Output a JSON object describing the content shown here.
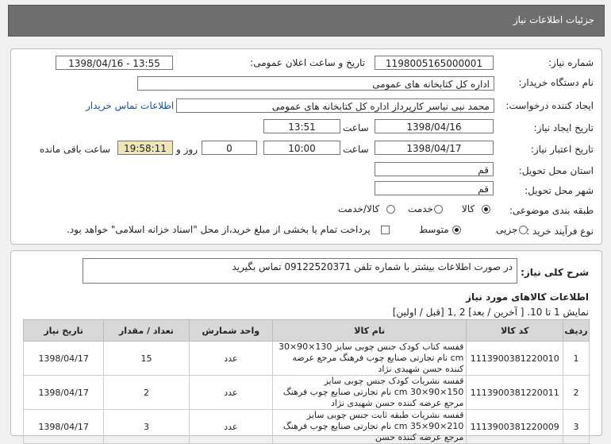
{
  "header": {
    "title": "جزئیات اطلاعات نیاز"
  },
  "form": {
    "need_number_label": "شماره نیاز:",
    "need_number": "1198005165000001",
    "announce_label": "تاریخ و ساعت اعلان عمومی:",
    "announce_value": "1398/04/16 - 13:55",
    "buyer_label": "نام دستگاه خریدار:",
    "buyer_value": "اداره کل کتابخانه های عمومی",
    "requester_label": "ایجاد کننده درخواست:",
    "requester_value": "محمد نبی نیاسر کارپرداز اداره کل کتابخانه های عمومی",
    "contact_link": "اطلاعات تماس خریدار",
    "create_date_label": "تاریخ ایجاد نیاز:",
    "create_date": "1398/04/16",
    "time_label": "ساعت",
    "create_time": "13:51",
    "valid_date_label": "تاریخ اعتبار نیاز:",
    "valid_date": "1398/04/17",
    "valid_time": "10:00",
    "days_value": "0",
    "days_label": "روز و",
    "remaining_time": "19:58:11",
    "remaining_label": "ساعت باقی مانده",
    "province_label": "استان محل تحویل:",
    "province_value": "قم",
    "city_label": "شهر محل تحویل:",
    "city_value": "قم",
    "category_label": "طبقه بندی موضوعی:",
    "category_options": [
      "کالا",
      "خدمت",
      "کالا/خدمت"
    ],
    "category_selected": "کالا",
    "process_label": "نوع فرآیند خرید :",
    "process_options": [
      "جزیی",
      "متوسط"
    ],
    "process_selected": "متوسط",
    "payment_note": "پرداخت تمام یا بخشی از مبلغ خرید،از محل \"اسناد خزانه اسلامی\" خواهد بود."
  },
  "description": {
    "label": "شرح کلی نیاز:",
    "text": "در صورت اطلاعات بیشتر با شماره تلفن 09122520371 تماس بگیرید"
  },
  "goods": {
    "title": "اطلاعات کالاهای مورد نیاز",
    "pagination": "نمایش 1 تا 10. [ آخرین / بعد] 2 ,1 [قبل / اولین]",
    "columns": [
      "ردیف",
      "کد کالا",
      "نام کالا",
      "واحد شمارش",
      "تعداد / مقدار",
      "تاریخ نیاز"
    ],
    "rows": [
      {
        "row": "1",
        "code": "1113900381220010",
        "name": "قفسه کتاب کودک جنس چوبی سایز 130×90×30 cm نام تجارتی صنایع چوب فرهنگ مرجع عرضه کننده حسن شهیدی نژاد",
        "unit": "عدد",
        "qty": "15",
        "date": "1398/04/17"
      },
      {
        "row": "2",
        "code": "1113900381220011",
        "name": "قفسه نشریات کودک جنس چوبی سایز 150×90×30 cm نام تجارتی صنایع چوب فرهنگ مرجع عرضه کننده حسن شهیدی نژاد",
        "unit": "عدد",
        "qty": "2",
        "date": "1398/04/17"
      },
      {
        "row": "3",
        "code": "1113900381220009",
        "name": "قفسه نشریات طبقه ثابت جنس چوبی سایز 210×90×35 cm نام تجارتی صنایع چوب فرهنگ مرجع عرضه کننده حسن",
        "unit": "عدد",
        "qty": "3",
        "date": "1398/04/17"
      }
    ]
  }
}
